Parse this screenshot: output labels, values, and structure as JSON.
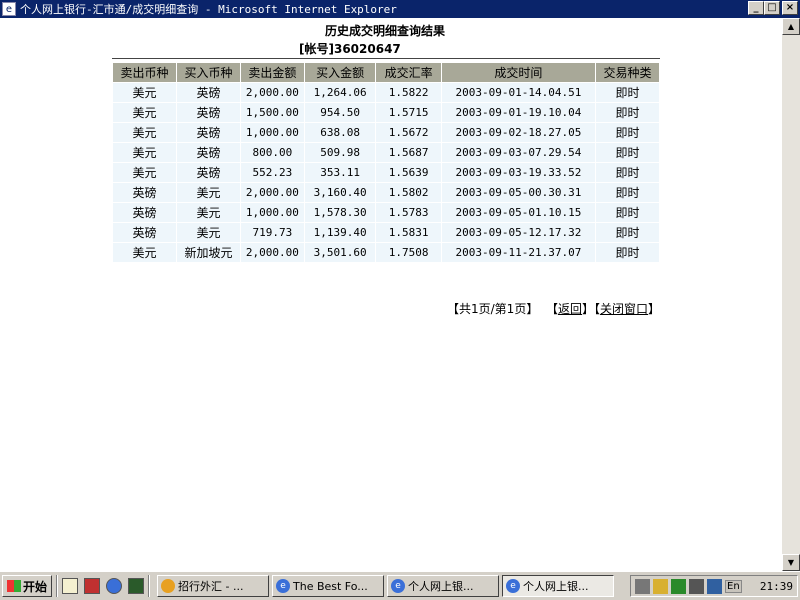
{
  "window": {
    "title": "个人网上银行-汇市通/成交明细查询 - Microsoft Internet Explorer",
    "minimize": "_",
    "maximize": "□",
    "close": "×"
  },
  "page": {
    "heading": "历史成交明细查询结果",
    "account_label": "[帐号]",
    "account_number": "36020647"
  },
  "table": {
    "headers": [
      "卖出币种",
      "买入币种",
      "卖出金额",
      "买入金额",
      "成交汇率",
      "成交时间",
      "交易种类"
    ],
    "rows": [
      [
        "美元",
        "英磅",
        "2,000.00",
        "1,264.06",
        "1.5822",
        "2003-09-01-14.04.51",
        "即时"
      ],
      [
        "美元",
        "英磅",
        "1,500.00",
        "954.50",
        "1.5715",
        "2003-09-01-19.10.04",
        "即时"
      ],
      [
        "美元",
        "英磅",
        "1,000.00",
        "638.08",
        "1.5672",
        "2003-09-02-18.27.05",
        "即时"
      ],
      [
        "美元",
        "英磅",
        "800.00",
        "509.98",
        "1.5687",
        "2003-09-03-07.29.54",
        "即时"
      ],
      [
        "美元",
        "英磅",
        "552.23",
        "353.11",
        "1.5639",
        "2003-09-03-19.33.52",
        "即时"
      ],
      [
        "英磅",
        "美元",
        "2,000.00",
        "3,160.40",
        "1.5802",
        "2003-09-05-00.30.31",
        "即时"
      ],
      [
        "英磅",
        "美元",
        "1,000.00",
        "1,578.30",
        "1.5783",
        "2003-09-05-01.10.15",
        "即时"
      ],
      [
        "英磅",
        "美元",
        "719.73",
        "1,139.40",
        "1.5831",
        "2003-09-05-12.17.32",
        "即时"
      ],
      [
        "美元",
        "新加坡元",
        "2,000.00",
        "3,501.60",
        "1.7508",
        "2003-09-11-21.37.07",
        "即时"
      ]
    ]
  },
  "pager": {
    "page_info": "【共1页/第1页】",
    "back_open": "【",
    "back_label": "返回",
    "back_close": "】",
    "close_open": "【",
    "close_label": "关闭窗口",
    "close_close": "】"
  },
  "taskbar": {
    "start_label": "开始",
    "tasks": [
      {
        "label": "招行外汇 - ...",
        "icon": "cmb-icon"
      },
      {
        "label": "The Best Fo...",
        "icon": "ie-icon"
      },
      {
        "label": "个人网上银...",
        "icon": "ie-icon"
      },
      {
        "label": "个人网上银...",
        "icon": "ie-icon",
        "active": true
      }
    ],
    "lang": "En",
    "clock": "21:39"
  },
  "colors": {
    "titlebar": "#0a246a",
    "header_bg": "#a8a898",
    "row_bg": "#eef6fb"
  }
}
